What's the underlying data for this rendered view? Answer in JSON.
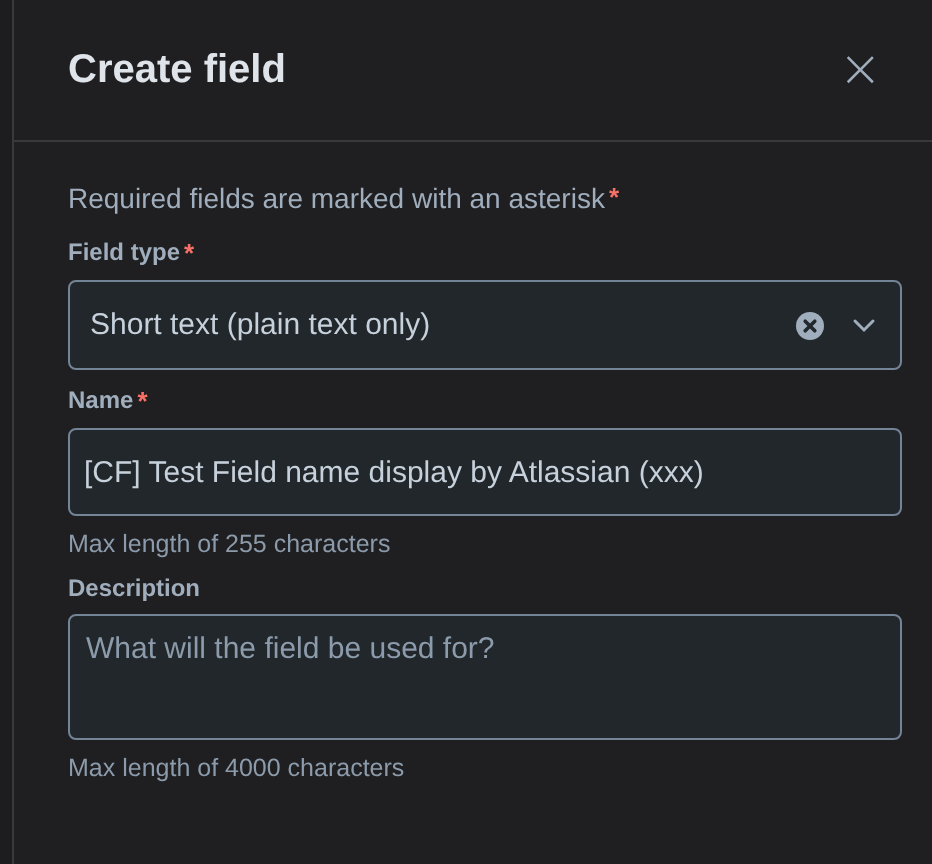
{
  "dialog": {
    "title": "Create field",
    "close": "×"
  },
  "required_note": {
    "text": "Required fields are marked with an asterisk",
    "asterisk": "*"
  },
  "fields": [
    {
      "kind": "select",
      "label": "Field type",
      "asterisk": "*",
      "value": "Short text (plain text only)",
      "clearable": true
    },
    {
      "kind": "text",
      "label": "Name",
      "asterisk": "*",
      "value": "[CF] Test Field name display by Atlassian (xxx)",
      "helper": "Max length of 255 characters"
    },
    {
      "kind": "textarea",
      "label": "Description",
      "placeholder": "What will the field be used for?",
      "helper": "Max length of 4000 characters"
    }
  ]
}
